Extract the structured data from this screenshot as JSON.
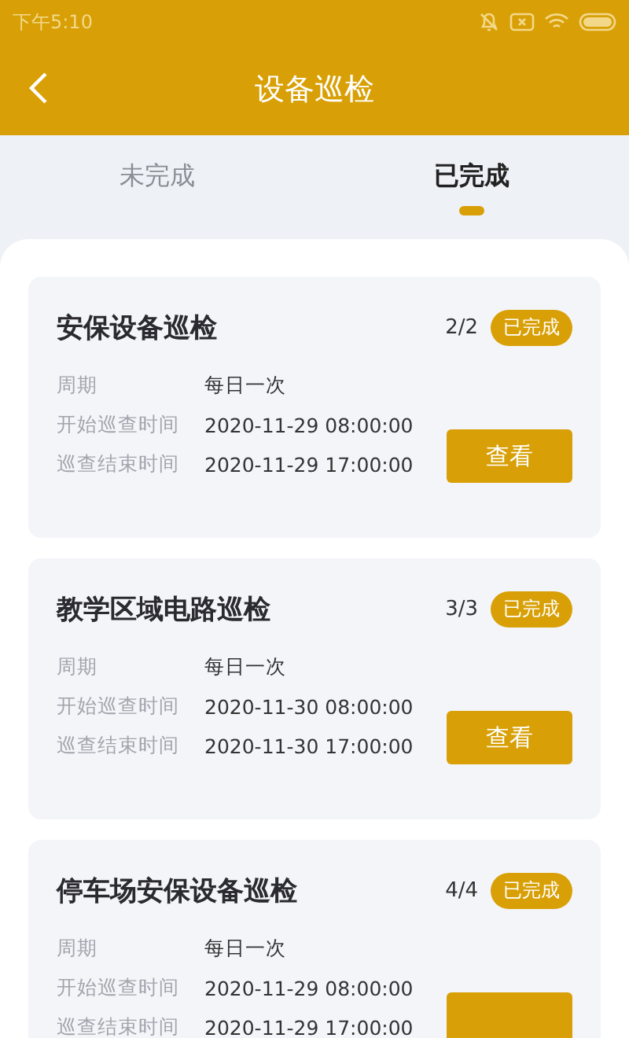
{
  "status_bar": {
    "time": "下午5:10"
  },
  "header": {
    "title": "设备巡检"
  },
  "tabs": [
    {
      "label": "未完成",
      "selected": false
    },
    {
      "label": "已完成",
      "selected": true
    }
  ],
  "cards": [
    {
      "title": "安保设备巡检",
      "progress": "2/2",
      "status": "已完成",
      "rows": [
        {
          "label": "周期",
          "value": "每日一次"
        },
        {
          "label": "开始巡查时间",
          "value": "2020-11-29 08:00:00"
        },
        {
          "label": "巡查结束时间",
          "value": "2020-11-29 17:00:00"
        }
      ],
      "button": "查看"
    },
    {
      "title": "教学区域电路巡检",
      "progress": "3/3",
      "status": "已完成",
      "rows": [
        {
          "label": "周期",
          "value": "每日一次"
        },
        {
          "label": "开始巡查时间",
          "value": "2020-11-30 08:00:00"
        },
        {
          "label": "巡查结束时间",
          "value": "2020-11-30 17:00:00"
        }
      ],
      "button": "查看"
    },
    {
      "title": "停车场安保设备巡检",
      "progress": "4/4",
      "status": "已完成",
      "rows": [
        {
          "label": "周期",
          "value": "每日一次"
        },
        {
          "label": "开始巡查时间",
          "value": "2020-11-29 08:00:00"
        },
        {
          "label": "巡查结束时间",
          "value": "2020-11-29 17:00:00"
        }
      ]
    }
  ]
}
